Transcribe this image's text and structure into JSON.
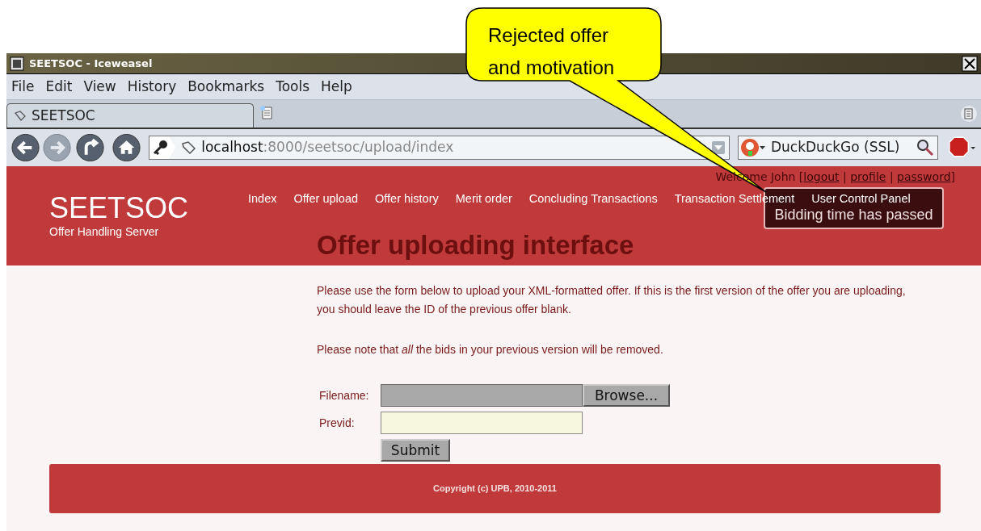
{
  "window": {
    "title": "SEETSOC - Iceweasel"
  },
  "menu": [
    {
      "label": "File"
    },
    {
      "label": "Edit"
    },
    {
      "label": "View"
    },
    {
      "label": "History"
    },
    {
      "label": "Bookmarks"
    },
    {
      "label": "Tools"
    },
    {
      "label": "Help"
    }
  ],
  "tabs": [
    {
      "label": "SEETSOC",
      "selected": true
    }
  ],
  "address_bar": {
    "host": "localhost",
    "path": ":8000/seetsoc/upload/index"
  },
  "search": {
    "placeholder": "DuckDuckGo (SSL)"
  },
  "site": {
    "brand": "SEETSOC",
    "tagline": "Offer Handling Server",
    "welcome": {
      "text": "Welcome John [",
      "links": [
        "logout",
        "profile",
        "password"
      ],
      "separator": "|",
      "end": "]"
    },
    "nav": [
      {
        "label": "Index"
      },
      {
        "label": "Offer upload"
      },
      {
        "label": "Offer history"
      },
      {
        "label": "Merit order"
      },
      {
        "label": "Concluding Transactions"
      },
      {
        "label": "Transaction Settlement"
      },
      {
        "label": "User Control Panel"
      }
    ],
    "heading": "Offer uploading interface",
    "paragraphs": [
      "Please use the form below to upload your XML-formatted offer. If this is the first version of the offer you are uploading, you should leave the ID of the previous offer blank.",
      "Please note that *all* the bids in your previous version will be removed."
    ],
    "form": {
      "fields": [
        {
          "kind": "file",
          "label": "Filename:",
          "button": "Browse..."
        },
        {
          "kind": "text",
          "label": "Previd:"
        }
      ],
      "submit": "Submit"
    },
    "footer": "Copyright (c) UPB, 2010-2011",
    "tooltip": "Bidding time has passed"
  },
  "callout": {
    "lines": [
      "Rejected offer",
      "and motivation"
    ]
  }
}
